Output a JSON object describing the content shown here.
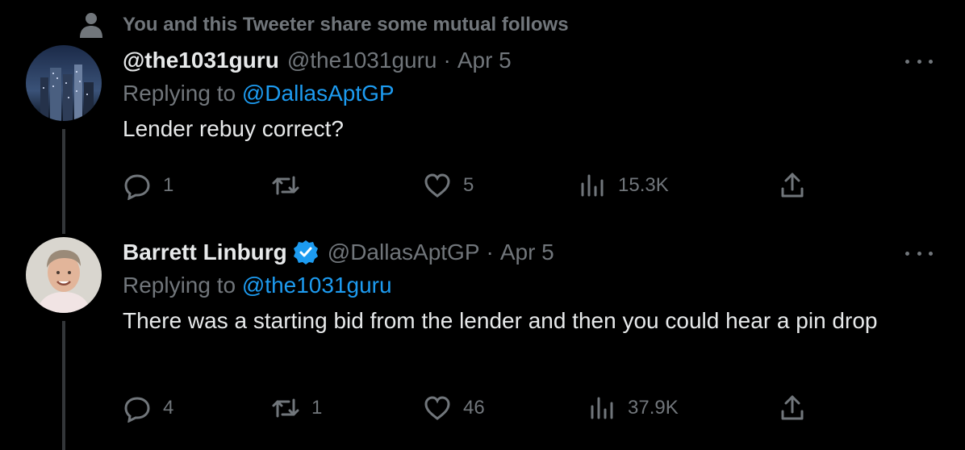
{
  "social_context": {
    "text": "You and this Tweeter share some mutual follows",
    "icon": "person-icon"
  },
  "tweets": [
    {
      "display_name": "@the1031guru",
      "handle": "@the1031guru",
      "separator": "·",
      "date": "Apr 5",
      "replying_prefix": "Replying to",
      "replying_to": "@DallasAptGP",
      "text": "Lender rebuy correct?",
      "verified": false,
      "actions": {
        "replies": "1",
        "retweets": "",
        "likes": "5",
        "views": "15.3K"
      }
    },
    {
      "display_name": "Barrett Linburg",
      "handle": "@DallasAptGP",
      "separator": "·",
      "date": "Apr 5",
      "replying_prefix": "Replying to",
      "replying_to": "@the1031guru",
      "text": "There was a starting bid from the lender and then you could hear a pin drop",
      "verified": true,
      "actions": {
        "replies": "4",
        "retweets": "1",
        "likes": "46",
        "views": "37.9K"
      }
    }
  ],
  "colors": {
    "background": "#000000",
    "text": "#e7e9ea",
    "muted": "#71767b",
    "link": "#1d9bf0",
    "verified": "#1d9bf0"
  }
}
